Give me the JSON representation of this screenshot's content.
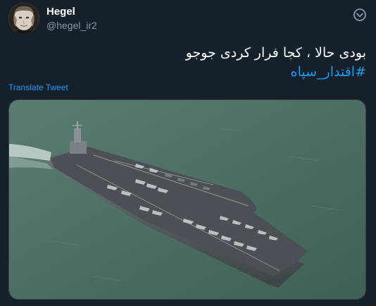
{
  "user": {
    "display_name": "Hegel",
    "handle": "@hegel_ir2",
    "avatar_icon": "portrait-avatar"
  },
  "tweet": {
    "text_line1": "بودی حالا ، کجا فرار کردی جوجو",
    "hashtag": "#اقتدار_سپاه",
    "translate_label": "Translate Tweet",
    "more_icon": "more-options-icon"
  },
  "media": {
    "subject": "aircraft-carrier-photo"
  },
  "colors": {
    "background": "#15202b",
    "text_primary": "#ffffff",
    "text_secondary": "#8b98a5",
    "accent": "#1d9bf0",
    "sea": "#4f7268"
  }
}
